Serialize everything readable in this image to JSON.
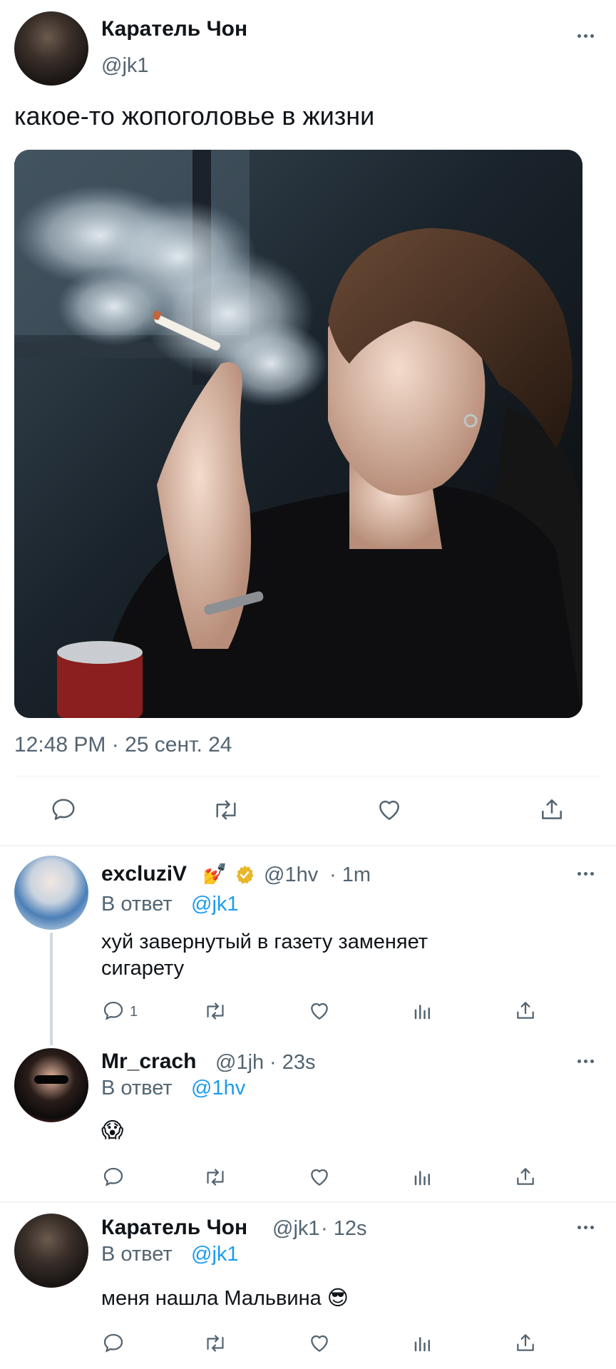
{
  "main_tweet": {
    "author_name": "Каратель Чон",
    "handle": "@jk1",
    "text": "какое-то жопоголовье в жизни",
    "timestamp": "12:48 PM · 25 сент. 24",
    "photo": "smoking-man-photo",
    "actions": [
      "reply-icon",
      "retweet-icon",
      "like-icon",
      "share-icon"
    ]
  },
  "replies": [
    {
      "author_name": "excluziV",
      "emoji": "💅",
      "verified": true,
      "handle": "@1hv",
      "time": "· 1m",
      "reply_prefix": "В ответ",
      "reply_to": "@jk1",
      "text_line1": "хуй завернутый в газету заменяет",
      "text_line2": "сигарету",
      "reply_count": "1"
    },
    {
      "author_name": "Mr_crach",
      "handle": "@1jh",
      "time": "· 23s",
      "reply_prefix": "В ответ",
      "reply_to": "@1hv",
      "text": "😱"
    },
    {
      "author_name": "Каратель Чон",
      "handle": "@jk1",
      "time": "· 12s",
      "reply_prefix": "В ответ",
      "reply_to": "@jk1",
      "text": "меня нашла Мальвина 😎"
    }
  ],
  "colors": {
    "text": "#0f1419",
    "secondary": "#536471",
    "link": "#1d9bf0",
    "verified": "#e8b72a",
    "divider": "#eff3f4"
  }
}
